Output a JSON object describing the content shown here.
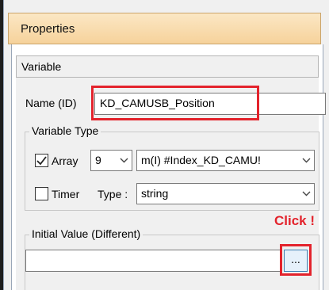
{
  "window": {
    "title": "Properties"
  },
  "section": {
    "label": "Variable"
  },
  "name_field": {
    "label": "Name (ID)",
    "value": "KD_CAMUSB_Position"
  },
  "variable_type": {
    "group_label": "Variable Type",
    "array": {
      "label": "Array",
      "checked": true,
      "size_value": "9",
      "index_value": "m(I) #Index_KD_CAMU!"
    },
    "timer": {
      "label": "Timer",
      "checked": false,
      "type_label": "Type :",
      "type_value": "string"
    }
  },
  "initial_value": {
    "group_label": "Initial Value (Different)",
    "value": "",
    "browse_label": "..."
  },
  "annotation": {
    "click_text": "Click !",
    "highlight_color": "#e3232c"
  },
  "icons": {
    "checkmark": "check-icon",
    "dropdown": "chevron-down-icon"
  }
}
